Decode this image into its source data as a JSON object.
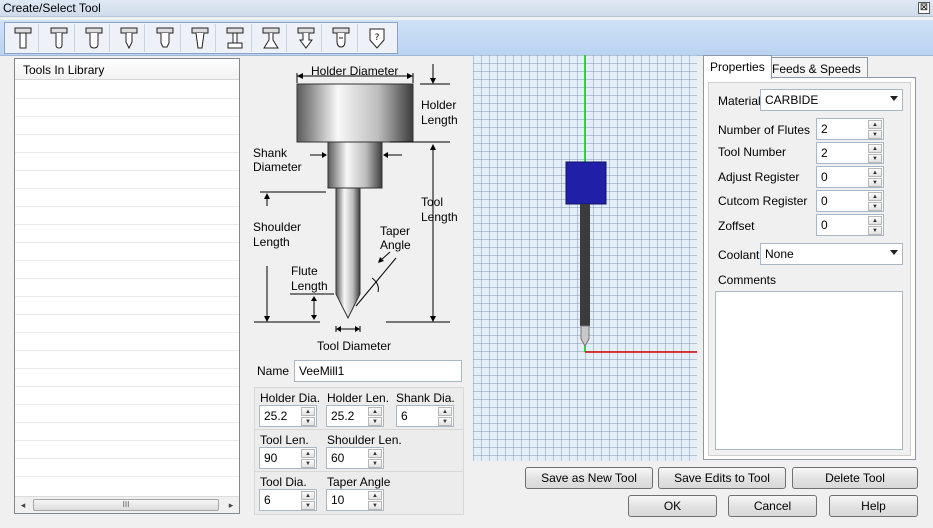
{
  "window": {
    "title": "Create/Select Tool",
    "close_glyph": "⊠"
  },
  "toolbar": {
    "icons": [
      "flat-end-mill-icon",
      "bull-nose-mill-icon",
      "ball-mill-icon",
      "vee-mill-icon",
      "chamfer-mill-icon",
      "taper-mill-icon",
      "slot-mill-icon",
      "dovetail-mill-icon",
      "drill-icon",
      "spot-drill-icon",
      "custom-tool-icon"
    ]
  },
  "library": {
    "header": "Tools In Library",
    "scroll_thumb": "III",
    "left_arrow": "◂",
    "right_arrow": "▸"
  },
  "diagram": {
    "holder_diameter": "Holder Diameter",
    "holder_length_1": "Holder",
    "holder_length_2": "Length",
    "shank_diameter_1": "Shank",
    "shank_diameter_2": "Diameter",
    "tool_length_1": "Tool",
    "tool_length_2": "Length",
    "shoulder_length_1": "Shoulder",
    "shoulder_length_2": "Length",
    "taper_angle_1": "Taper",
    "taper_angle_2": "Angle",
    "flute_length_1": "Flute",
    "flute_length_2": "Length",
    "tool_diameter": "Tool Diameter"
  },
  "name": {
    "label": "Name",
    "value": "VeeMill1"
  },
  "params": {
    "holder_dia": {
      "label": "Holder Dia.",
      "value": "25.2"
    },
    "holder_len": {
      "label": "Holder Len.",
      "value": "25.2"
    },
    "shank_dia": {
      "label": "Shank Dia.",
      "value": "6"
    },
    "tool_len": {
      "label": "Tool Len.",
      "value": "90"
    },
    "shoulder_len": {
      "label": "Shoulder Len.",
      "value": "60"
    },
    "tool_dia": {
      "label": "Tool Dia.",
      "value": "6"
    },
    "taper_angle": {
      "label": "Taper Angle",
      "value": "10"
    }
  },
  "tabs": {
    "properties": "Properties",
    "feeds": "Feeds & Speeds"
  },
  "properties": {
    "material_label": "Material",
    "material_value": "CARBIDE",
    "flutes_label": "Number of Flutes",
    "flutes_value": "2",
    "tool_number_label": "Tool Number",
    "tool_number_value": "2",
    "adjust_label": "Adjust Register",
    "adjust_value": "0",
    "cutcom_label": "Cutcom Register",
    "cutcom_value": "0",
    "zoffset_label": "Zoffset",
    "zoffset_value": "0",
    "coolant_label": "Coolant",
    "coolant_value": "None",
    "comments_label": "Comments"
  },
  "buttons": {
    "save_new": "Save as New Tool",
    "save_edits": "Save Edits to Tool",
    "delete": "Delete Tool",
    "ok": "OK",
    "cancel": "Cancel",
    "help": "Help"
  },
  "glyphs": {
    "up": "▲",
    "down": "▼"
  },
  "colors": {
    "holder": "#1f1fa8",
    "axis_y": "#00cc00",
    "axis_x": "#dd0000",
    "accent": "#b9d3f1"
  }
}
